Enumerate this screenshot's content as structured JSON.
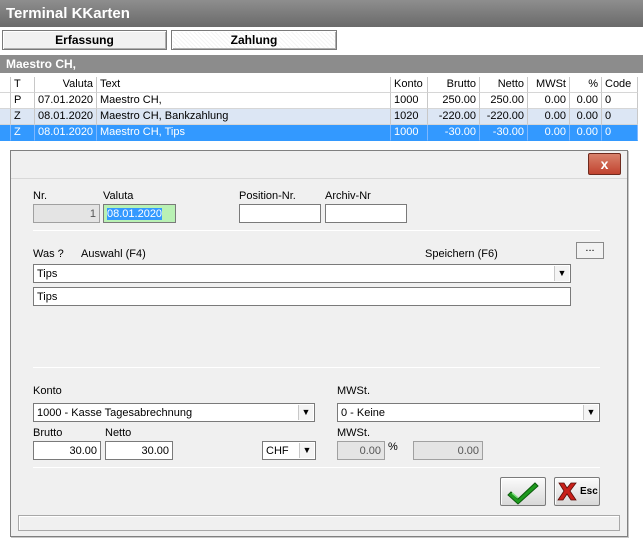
{
  "window": {
    "title": "Terminal KKarten"
  },
  "tabs": [
    {
      "label": "Erfassung"
    },
    {
      "label": "Zahlung"
    }
  ],
  "section": {
    "title": "Maestro CH,"
  },
  "table": {
    "headers": {
      "t": "T",
      "valuta": "Valuta",
      "text": "Text",
      "konto": "Konto",
      "brutto": "Brutto",
      "netto": "Netto",
      "mwst": "MWSt",
      "pct": "%",
      "code": "Code"
    },
    "rows": [
      {
        "t": "P",
        "valuta": "07.01.2020",
        "text": "Maestro CH,",
        "konto": "1000",
        "brutto": "250.00",
        "netto": "250.00",
        "mwst": "0.00",
        "pct": "0.00",
        "code": "0"
      },
      {
        "t": "Z",
        "valuta": "08.01.2020",
        "text": "Maestro CH, Bankzahlung",
        "konto": "1020",
        "brutto": "-220.00",
        "netto": "-220.00",
        "mwst": "0.00",
        "pct": "0.00",
        "code": "0"
      },
      {
        "t": "Z",
        "valuta": "08.01.2020",
        "text": "Maestro CH, Tips",
        "konto": "1000",
        "brutto": "-30.00",
        "netto": "-30.00",
        "mwst": "0.00",
        "pct": "0.00",
        "code": "0"
      }
    ]
  },
  "dialog": {
    "close_label": "x",
    "nr": {
      "label": "Nr.",
      "value": "1"
    },
    "valuta": {
      "label": "Valuta",
      "value": "08.01.2020"
    },
    "position": {
      "label": "Position-Nr.",
      "value": ""
    },
    "archiv": {
      "label": "Archiv-Nr",
      "value": ""
    },
    "was": {
      "label": "Was ?",
      "auswahl": "Auswahl (F4)",
      "speichern": "Speichern (F6)",
      "more_label": "...",
      "combo_value": "Tips",
      "text_value": "Tips"
    },
    "konto": {
      "label": "Konto",
      "value": "1000 - Kasse Tagesabrechnung"
    },
    "mwst_code": {
      "label": "MWSt.",
      "value": "0 - Keine"
    },
    "brutto": {
      "label": "Brutto",
      "value": "30.00"
    },
    "netto": {
      "label": "Netto",
      "value": "30.00"
    },
    "currency": {
      "value": "CHF"
    },
    "mwst_amount": {
      "label": "MWSt.",
      "rate": "0.00",
      "pct_sign": "%",
      "amount": "0.00"
    },
    "esc_label": "Esc",
    "colors": {
      "ok_green": "#1e9a1e",
      "cancel_red": "#c8201a",
      "selection_blue": "#3399ff",
      "valuta_bg": "#b9f1b4"
    }
  }
}
